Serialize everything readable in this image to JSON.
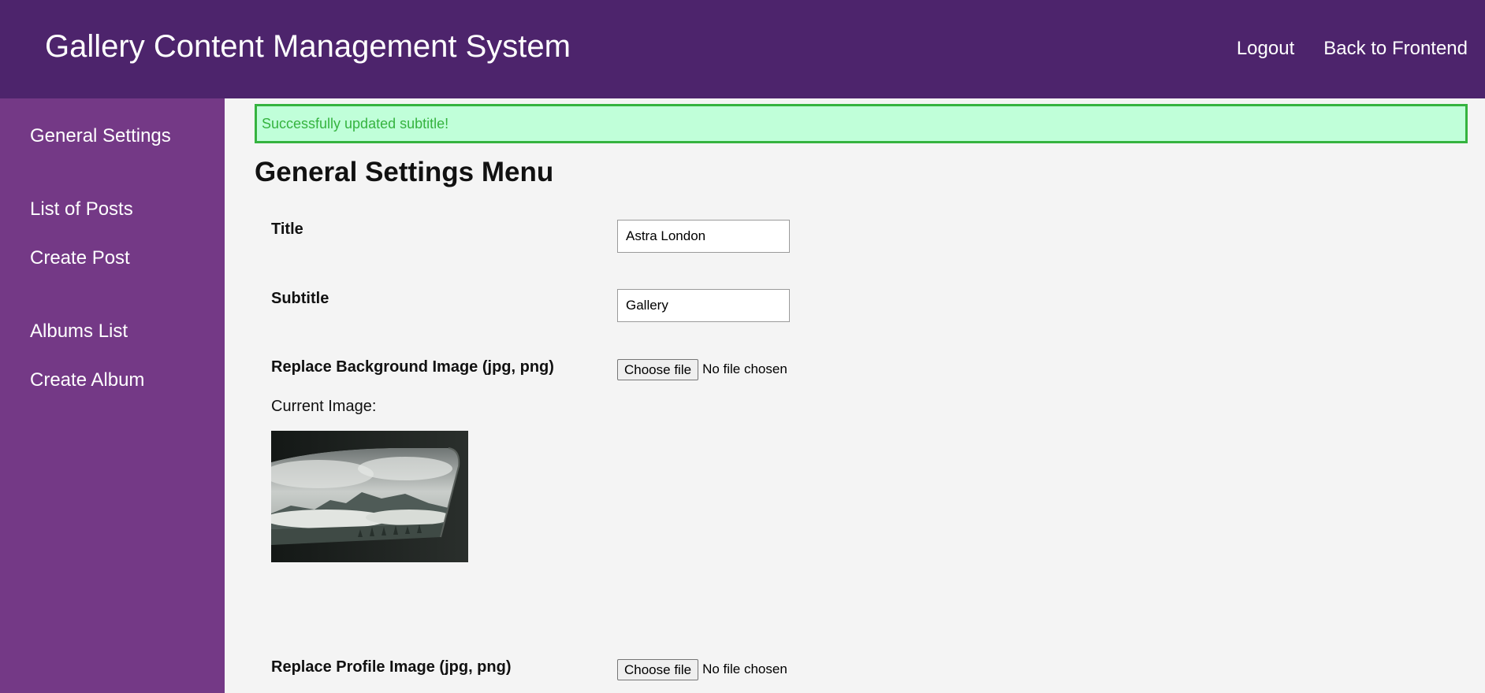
{
  "header": {
    "title": "Gallery Content Management System",
    "nav": {
      "logout": "Logout",
      "back_to_frontend": "Back to Frontend"
    }
  },
  "sidebar": {
    "items": [
      {
        "label": "General Settings"
      },
      {
        "label": "List of Posts"
      },
      {
        "label": "Create Post"
      },
      {
        "label": "Albums List"
      },
      {
        "label": "Create Album"
      }
    ]
  },
  "alert": {
    "message": "Successfully updated subtitle!"
  },
  "main": {
    "page_title": "General Settings Menu",
    "fields": {
      "title": {
        "label": "Title",
        "value": "Astra London"
      },
      "subtitle": {
        "label": "Subtitle",
        "value": "Gallery"
      },
      "background_image": {
        "label": "Replace Background Image (jpg, png)",
        "button_label": "Choose file",
        "status": "No file chosen",
        "current_image_label": "Current Image:"
      },
      "profile_image": {
        "label": "Replace Profile Image (jpg, png)",
        "button_label": "Choose file",
        "status": "No file chosen"
      }
    }
  },
  "colors": {
    "header_bg": "#4d246c",
    "sidebar_bg": "#743986",
    "content_bg": "#f4f4f4",
    "alert_bg": "#c0ffd9",
    "alert_border": "#35b33f",
    "alert_text": "#35b33f"
  }
}
